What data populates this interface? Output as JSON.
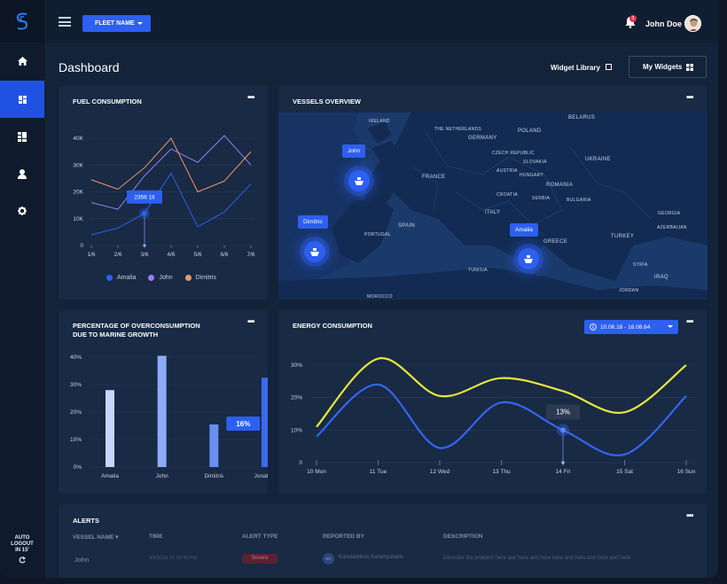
{
  "topbar": {
    "fleet_button": "FLEET NAME",
    "notification_count": "3",
    "user_name": "John Doe"
  },
  "sidebar": {
    "items": [
      {
        "name": "home",
        "icon": "home-icon"
      },
      {
        "name": "dashboard",
        "icon": "dashboard-icon",
        "active": true
      },
      {
        "name": "reports",
        "icon": "reports-icon"
      },
      {
        "name": "users",
        "icon": "user-icon"
      },
      {
        "name": "settings",
        "icon": "gear-icon"
      }
    ],
    "auto_logout_line1": "AUTO",
    "auto_logout_line2": "LOGOUT",
    "auto_logout_line3": "IN 15'"
  },
  "header": {
    "title": "Dashboard",
    "widget_library": "Widget Library",
    "my_widgets": "My Widgets"
  },
  "colors": {
    "accent": "#2d5ff0",
    "amalia": "#2d5ff0",
    "john": "#9a7cf2",
    "dimitris": "#f2936a",
    "energy_yellow": "#e8e63a",
    "energy_blue": "#3366f0"
  },
  "fuel": {
    "title": "FUEL CONSUMPTION",
    "tooltip": "2356 1lt",
    "legend": [
      "Amalia",
      "John",
      "Dimitris"
    ]
  },
  "vessels": {
    "title": "VESSELS OVERVIEW",
    "pins": [
      "John",
      "Dimitris",
      "Amalia"
    ],
    "countries": [
      {
        "label": "IRELAND",
        "big": false
      },
      {
        "label": "THE NETHERLANDS",
        "big": false
      },
      {
        "label": "POLAND",
        "big": true
      },
      {
        "label": "BELARUS",
        "big": true
      },
      {
        "label": "GERMANY",
        "big": true
      },
      {
        "label": "CZECH REPUBLIC",
        "big": false
      },
      {
        "label": "SLOVAKIA",
        "big": false
      },
      {
        "label": "UKRAINE",
        "big": true
      },
      {
        "label": "AUSTRIA",
        "big": false
      },
      {
        "label": "HUNGARY",
        "big": false
      },
      {
        "label": "FRANCE",
        "big": true
      },
      {
        "label": "ROMANIA",
        "big": true
      },
      {
        "label": "CROATIA",
        "big": false
      },
      {
        "label": "SERBIA",
        "big": false
      },
      {
        "label": "BULGARIA",
        "big": false
      },
      {
        "label": "ITALY",
        "big": true
      },
      {
        "label": "GEORGIA",
        "big": false
      },
      {
        "label": "SPAIN",
        "big": true
      },
      {
        "label": "PORTUGAL",
        "big": false
      },
      {
        "label": "AZERBAIJAN",
        "big": false
      },
      {
        "label": "GREECE",
        "big": true
      },
      {
        "label": "TURKEY",
        "big": true
      },
      {
        "label": "SYRIA",
        "big": false
      },
      {
        "label": "TUNISIA",
        "big": false
      },
      {
        "label": "IRAQ",
        "big": true
      },
      {
        "label": "JORDAN",
        "big": false
      },
      {
        "label": "MOROCCO",
        "big": false
      }
    ]
  },
  "overconsumption": {
    "title_line1": "PERCENTAGE OF OVERCONSUMPTION",
    "title_line2": "DUE TO MARINE GROWTH",
    "tooltip": "16%"
  },
  "energy": {
    "title": "ENERGY CONSUMPTION",
    "date_range": "10.06.18 - 16.08.64",
    "tooltip": "13%"
  },
  "alerts": {
    "title": "ALERTS",
    "columns": [
      "VESSEL NAME",
      "TIME",
      "ALERT TYPE",
      "REPORTED BY",
      "DESCRIPTION"
    ],
    "row": {
      "vessel": "John",
      "time": "9/5/2018 21:23:43 PM",
      "type": "Severe",
      "reporter_initials": "KK",
      "reporter": "Konstantinos Karampatakis",
      "description": "Describe the problem here and here and here here and here and here and here"
    }
  },
  "chart_data": [
    {
      "type": "line",
      "title": "FUEL CONSUMPTION",
      "categories": [
        "1/6",
        "2/6",
        "3/6",
        "4/6",
        "5/6",
        "6/6",
        "7/6"
      ],
      "y_ticks": [
        "0",
        "10K",
        "20K",
        "30K",
        "40K"
      ],
      "ylim": [
        0,
        40000
      ],
      "series": [
        {
          "name": "Amalia",
          "color": "#2d5ff0",
          "values": [
            4000,
            6500,
            12000,
            27000,
            7000,
            12500,
            23000
          ]
        },
        {
          "name": "John",
          "color": "#9a7cf2",
          "values": [
            16000,
            13500,
            26000,
            36000,
            31000,
            41000,
            30000
          ]
        },
        {
          "name": "Dimitris",
          "color": "#f2936a",
          "values": [
            24500,
            21000,
            29000,
            40000,
            20000,
            24000,
            35000
          ]
        }
      ],
      "tooltip": {
        "category": "3/6",
        "value": "2356 1lt"
      }
    },
    {
      "type": "bar",
      "title": "PERCENTAGE OF OVERCONSUMPTION DUE TO MARINE GROWTH",
      "categories": [
        "Amalia",
        "John",
        "Dimitris",
        "Jonathan"
      ],
      "values": [
        28,
        40.5,
        15.5,
        32.5
      ],
      "y_ticks": [
        "0%",
        "10%",
        "20%",
        "30%",
        "40%"
      ],
      "ylim": [
        0,
        40
      ],
      "tooltip": {
        "category": "Dimitris",
        "value": "16%"
      }
    },
    {
      "type": "line",
      "title": "ENERGY CONSUMPTION",
      "categories": [
        "10 Mon",
        "11 Tue",
        "12 Wed",
        "13 Thu",
        "14 Fri",
        "15 Sat",
        "16 Sun"
      ],
      "y_ticks": [
        "0",
        "10%",
        "20%",
        "30%"
      ],
      "ylim": [
        0,
        30
      ],
      "series": [
        {
          "color": "#e8e63a",
          "values": [
            11,
            32,
            20.5,
            26,
            22,
            15.5,
            30
          ]
        },
        {
          "color": "#3366f0",
          "values": [
            8,
            24,
            4.5,
            18.5,
            10,
            2.5,
            20.5
          ]
        }
      ],
      "tooltip": {
        "category": "14 Fri",
        "value": "13%"
      }
    }
  ]
}
